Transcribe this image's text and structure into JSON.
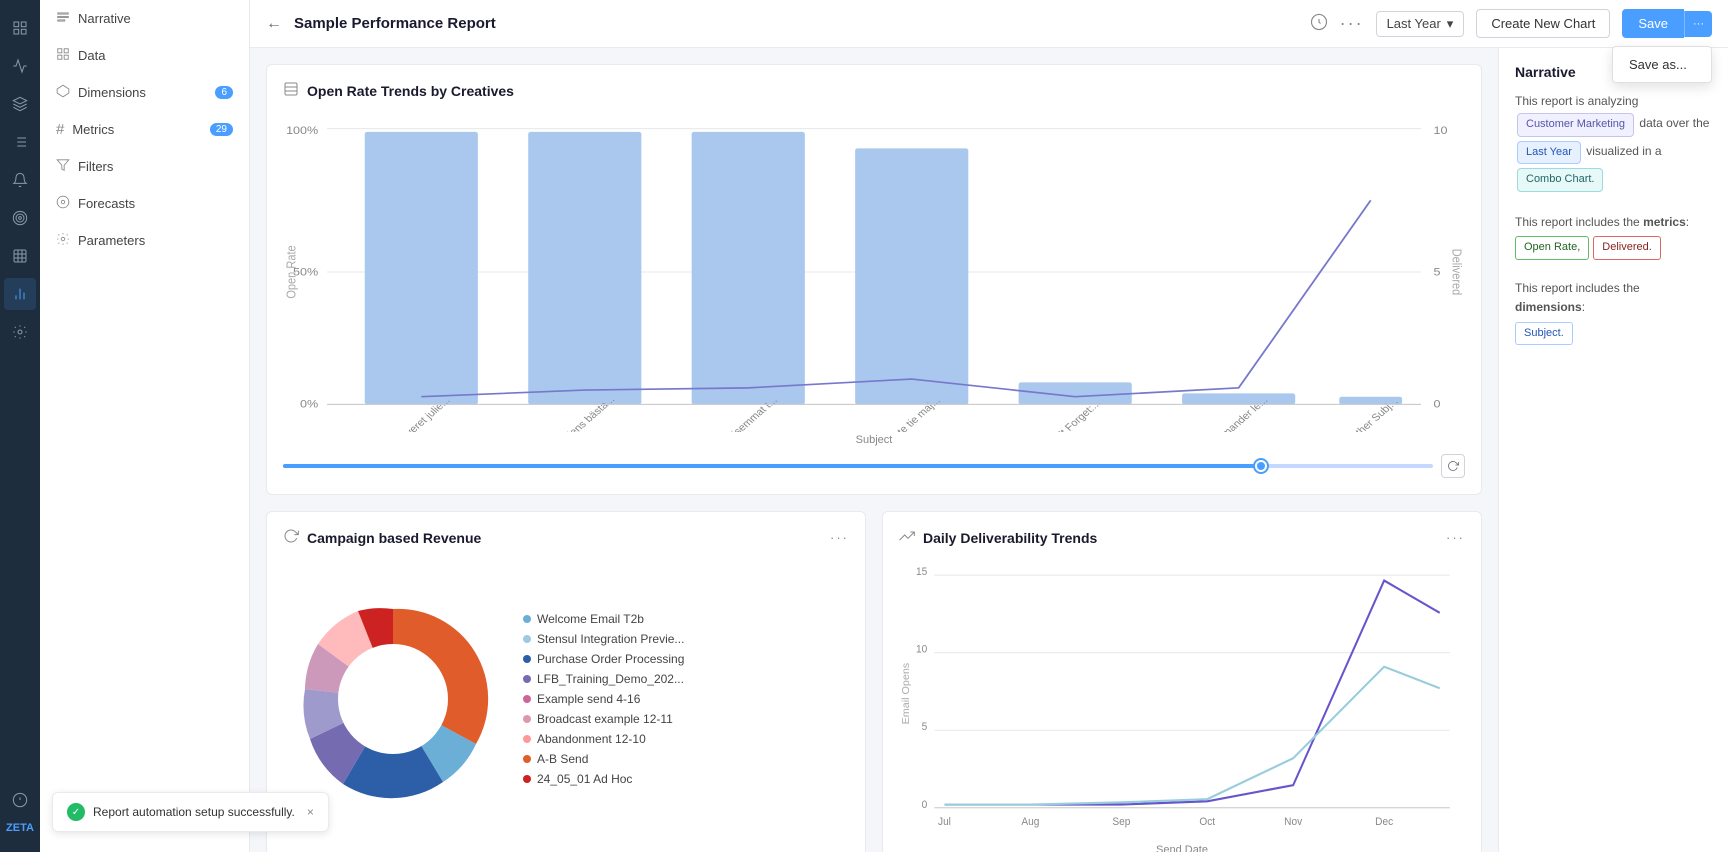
{
  "app": {
    "title": "Sample Performance Report",
    "save_label": "Save",
    "save_as_label": "Save as...",
    "create_chart_label": "Create New Chart",
    "date_filter": "Last Year"
  },
  "nav": {
    "items": [
      {
        "id": "narrative",
        "label": "Narrative",
        "icon": "≡",
        "badge": null
      },
      {
        "id": "data",
        "label": "Data",
        "icon": "⊞",
        "badge": null
      },
      {
        "id": "dimensions",
        "label": "Dimensions",
        "icon": "⬡",
        "badge": "6"
      },
      {
        "id": "metrics",
        "label": "Metrics",
        "icon": "#",
        "badge": "29"
      },
      {
        "id": "filters",
        "label": "Filters",
        "icon": "▼",
        "badge": null
      },
      {
        "id": "forecasts",
        "label": "Forecasts",
        "icon": "◎",
        "badge": null
      },
      {
        "id": "parameters",
        "label": "Parameters",
        "icon": "⚙",
        "badge": null
      }
    ]
  },
  "charts": {
    "open_rate": {
      "title": "Open Rate Trends by Creatives",
      "x_label": "Subject",
      "y_left_label": "Open Rate",
      "y_right_label": "Delivered",
      "bars": [
        {
          "label": "Få leveret julie...",
          "height_pct": 95
        },
        {
          "label": "Få julens bästa...",
          "height_pct": 95
        },
        {
          "label": "Edullisemmat t...",
          "height_pct": 95
        },
        {
          "label": "Donate tie maj...",
          "height_pct": 88
        },
        {
          "label": "Don't Forget:...",
          "height_pct": 0
        },
        {
          "label": "Commander le...",
          "height_pct": 0
        },
        {
          "label": "All Other Subj...",
          "height_pct": 0
        }
      ],
      "y_ticks_left": [
        "100%",
        "50%",
        "0%"
      ],
      "y_ticks_right": [
        "10",
        "5",
        "0"
      ]
    },
    "campaign_revenue": {
      "title": "Campaign based Revenue",
      "icon": "↻",
      "legend": [
        {
          "label": "Welcome Email T2b",
          "color": "#6baed6"
        },
        {
          "label": "Stensul Integration Previe...",
          "color": "#9ecae1"
        },
        {
          "label": "Purchase Order Processing",
          "color": "#2c5fa8"
        },
        {
          "label": "LFB_Training_Demo_202...",
          "color": "#756bb1"
        },
        {
          "label": "Example send 4-16",
          "color": "#cc6699"
        },
        {
          "label": "Broadcast example 12-11",
          "color": "#dd99aa"
        },
        {
          "label": "Abandonment 12-10",
          "color": "#ff9999"
        },
        {
          "label": "A-B Send",
          "color": "#e05c2a"
        },
        {
          "label": "24_05_01 Ad Hoc",
          "color": "#cc2222"
        }
      ]
    },
    "daily_deliverability": {
      "title": "Daily Deliverability Trends",
      "x_label": "Send Date",
      "y_label": "Email Opens",
      "x_ticks": [
        "Jul",
        "Aug",
        "Sep",
        "Oct",
        "Nov",
        "Dec"
      ],
      "y_ticks": [
        "15",
        "10",
        "5",
        "0"
      ]
    }
  },
  "narrative": {
    "title": "Narrative",
    "analyzing_label": "This report is analyzing",
    "over_label": "data over the",
    "visualized_label": "visualized in a",
    "includes_metrics_label": "This report includes the metrics:",
    "includes_dimensions_label": "This report includes the dimensions:",
    "customer_marketing_tag": "Customer Marketing",
    "last_year_tag": "Last Year",
    "combo_chart_tag": "Combo Chart.",
    "metric_tags": [
      "Open Rate,",
      "Delivered."
    ],
    "dimension_tags": [
      "Subject."
    ]
  },
  "toast": {
    "message": "Report automation setup successfully.",
    "close_label": "×"
  },
  "icons": {
    "left_sidebar": [
      "grid",
      "chart-bar",
      "layers",
      "hashtag",
      "bell",
      "target",
      "grid-2",
      "settings",
      "alert"
    ],
    "grid_icon": "⊞",
    "chart_icon": "📊",
    "nav_icon": "⊟"
  }
}
